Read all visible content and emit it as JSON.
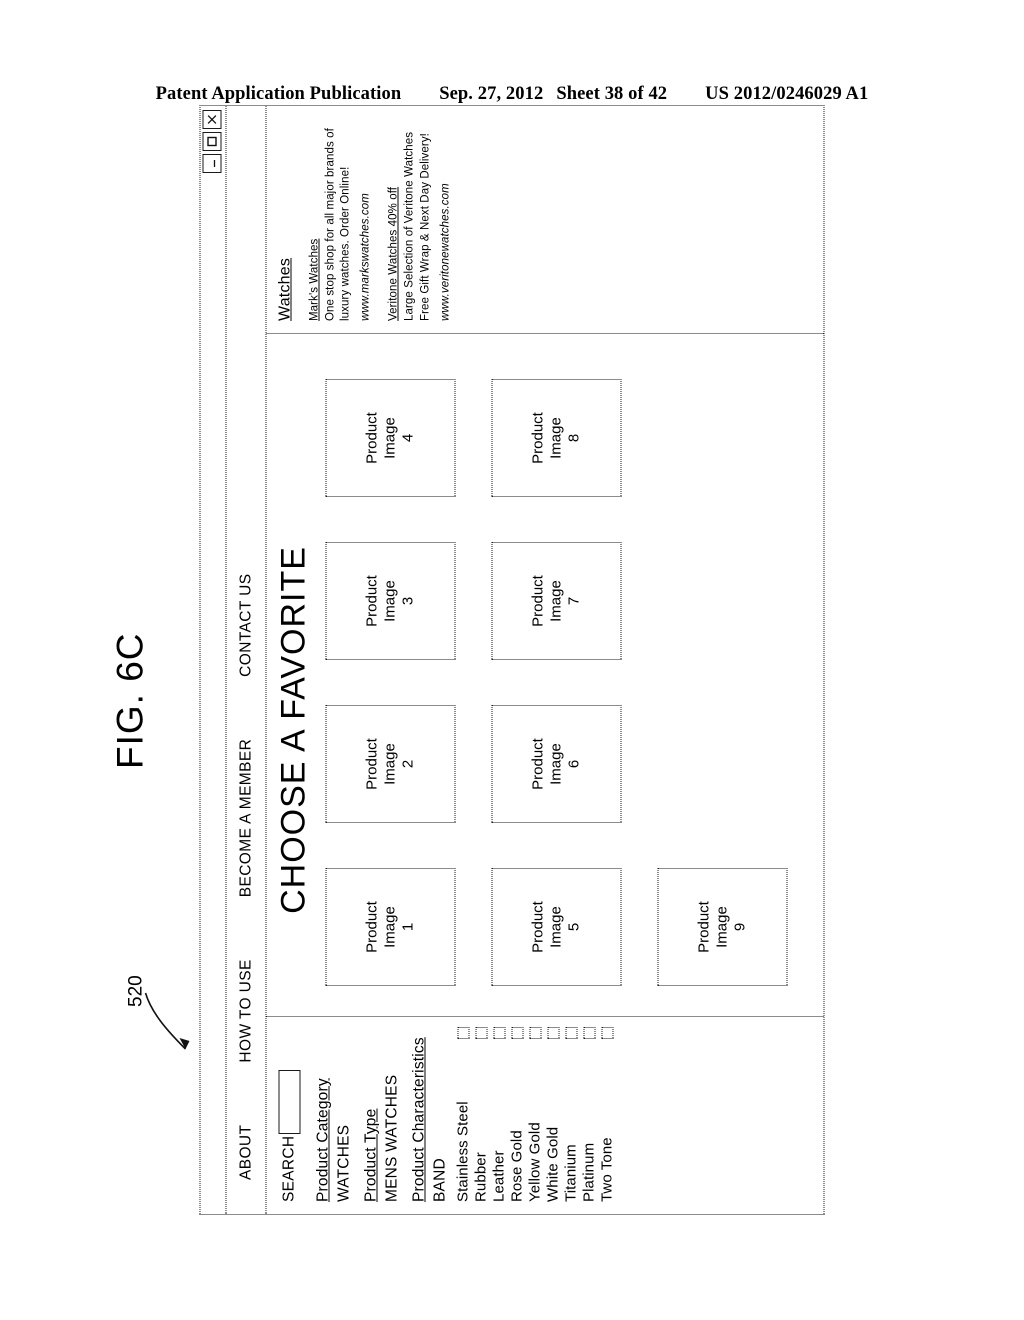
{
  "page_header": {
    "publication": "Patent Application Publication",
    "date": "Sep. 27, 2012",
    "sheet": "Sheet 38 of 42",
    "patent_number": "US 2012/0246029 A1"
  },
  "figure": {
    "label": "FIG. 6C",
    "callout": "520"
  },
  "window": {
    "controls": [
      {
        "name": "minimize-button",
        "glyph": "minimize"
      },
      {
        "name": "maximize-button",
        "glyph": "maximize"
      },
      {
        "name": "close-button",
        "glyph": "close"
      }
    ]
  },
  "nav": {
    "items": [
      {
        "label": "ABOUT"
      },
      {
        "label": "HOW TO USE"
      },
      {
        "label": "BECOME A MEMBER"
      },
      {
        "label": "CONTACT US"
      }
    ]
  },
  "sidebar": {
    "search_label": "SEARCH",
    "search_value": "",
    "search_placeholder": "",
    "facets": [
      {
        "heading": "Product Category",
        "value": "WATCHES"
      },
      {
        "heading": "Product Type",
        "value": "MENS WATCHES"
      },
      {
        "heading": "Product Characteristics",
        "value": ""
      }
    ],
    "group_label": "BAND",
    "options": [
      {
        "label": "Stainless Steel",
        "checked": false
      },
      {
        "label": "Rubber",
        "checked": false
      },
      {
        "label": "Leather",
        "checked": false
      },
      {
        "label": "Rose Gold",
        "checked": false
      },
      {
        "label": "Yellow Gold",
        "checked": false
      },
      {
        "label": "White Gold",
        "checked": false
      },
      {
        "label": "Titanium",
        "checked": false
      },
      {
        "label": "Platinum",
        "checked": false
      },
      {
        "label": "Two Tone",
        "checked": false
      }
    ]
  },
  "content": {
    "title": "CHOOSE A FAVORITE",
    "tiles": [
      {
        "line1": "Product",
        "line2": "Image",
        "number": "1"
      },
      {
        "line1": "Product",
        "line2": "Image",
        "number": "2"
      },
      {
        "line1": "Product",
        "line2": "Image",
        "number": "3"
      },
      {
        "line1": "Product",
        "line2": "Image",
        "number": "4"
      },
      {
        "line1": "Product",
        "line2": "Image",
        "number": "5"
      },
      {
        "line1": "Product",
        "line2": "Image",
        "number": "6"
      },
      {
        "line1": "Product",
        "line2": "Image",
        "number": "7"
      },
      {
        "line1": "Product",
        "line2": "Image",
        "number": "8"
      },
      {
        "line1": "Product",
        "line2": "Image",
        "number": "9"
      }
    ]
  },
  "ads": {
    "heading": "Watches",
    "items": [
      {
        "title": "Mark's Watches",
        "line1": "One stop shop for all major brands of",
        "line2": "luxury watches. Order Online!",
        "url": "www.markswatches.com"
      },
      {
        "title": "Veritone Watches 40% off",
        "line1": "Large Selection of Veritone Watches",
        "line2": "Free Gift Wrap & Next Day Delivery!",
        "url": "www.veritonewatches.com"
      }
    ]
  },
  "colors": {
    "ink": "#000000",
    "paper": "#ffffff"
  }
}
